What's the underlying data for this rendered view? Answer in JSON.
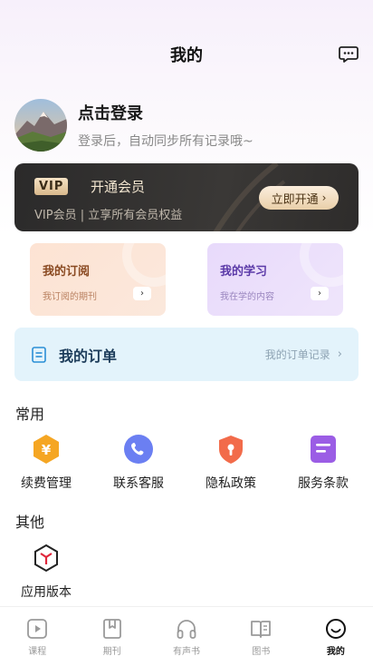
{
  "header": {
    "title": "我的"
  },
  "profile": {
    "login_title": "点击登录",
    "login_subtitle": "登录后，自动同步所有记录哦~"
  },
  "vip": {
    "badge": "VIP",
    "title": "开通会员",
    "desc": "VIP会员 | 立享所有会员权益",
    "button": "立即开通",
    "button_chevron": "›"
  },
  "tiles": [
    {
      "title": "我的订阅",
      "subtitle": "我订阅的期刊",
      "arrow": "›"
    },
    {
      "title": "我的学习",
      "subtitle": "我在学的内容",
      "arrow": "›"
    }
  ],
  "orders": {
    "title": "我的订单",
    "link": "我的订单记录",
    "chevron": "›"
  },
  "common": {
    "title": "常用",
    "items": [
      {
        "label": "续费管理",
        "icon": "renewal-yen-icon",
        "color": "#f5a623"
      },
      {
        "label": "联系客服",
        "icon": "phone-icon",
        "color": "#6b7ff2"
      },
      {
        "label": "隐私政策",
        "icon": "shield-lock-icon",
        "color": "#f26b4a"
      },
      {
        "label": "服务条款",
        "icon": "document-icon",
        "color": "#9b5de5"
      }
    ]
  },
  "other": {
    "title": "其他",
    "items": [
      {
        "label": "应用版本",
        "icon": "app-version-icon",
        "color": "#e0263b"
      }
    ]
  },
  "tabbar": [
    {
      "label": "课程",
      "icon": "video-icon",
      "active": false
    },
    {
      "label": "期刊",
      "icon": "bookmark-icon",
      "active": false
    },
    {
      "label": "有声书",
      "icon": "headphones-icon",
      "active": false
    },
    {
      "label": "图书",
      "icon": "open-book-icon",
      "active": false
    },
    {
      "label": "我的",
      "icon": "smile-face-icon",
      "active": true
    }
  ]
}
